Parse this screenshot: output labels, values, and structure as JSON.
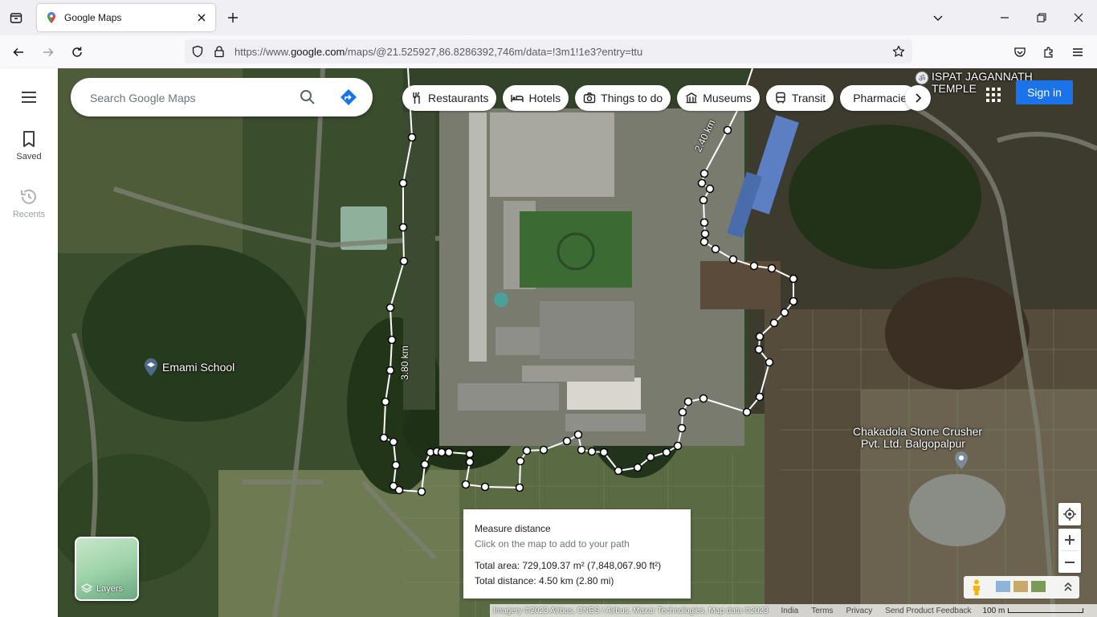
{
  "browser": {
    "tab_title": "Google Maps",
    "url_prefix": "https://www.",
    "url_domain": "google.com",
    "url_rest": "/maps/@21.525927,86.8286392,746m/data=!3m1!1e3?entry=ttu"
  },
  "rail": {
    "saved_label": "Saved",
    "recents_label": "Recents"
  },
  "search": {
    "placeholder": "Search Google Maps"
  },
  "chips": {
    "restaurants": "Restaurants",
    "hotels": "Hotels",
    "things_to_do": "Things to do",
    "museums": "Museums",
    "transit": "Transit",
    "pharmacies": "Pharmacies"
  },
  "header": {
    "sign_in": "Sign in"
  },
  "map_labels": {
    "temple_line1": "ISPAT JAGANNATH",
    "temple_line2": "TEMPLE",
    "emami_school": "Emami School",
    "crusher_line1": "Chakadola Stone Crusher",
    "crusher_line2": "Pvt. Ltd. Balgopalpur",
    "dist_top": "2.40 km",
    "dist_left": "3.80 km"
  },
  "measure": {
    "title": "Measure distance",
    "hint": "Click on the map to add to your path",
    "total_area": "Total area: 729,109.37 m² (7,848,067.90 ft²)",
    "total_distance": "Total distance: 4.50 km (2.80 mi)"
  },
  "layers": {
    "label": "Layers"
  },
  "footer": {
    "imagery": "Imagery ©2023 Airbus, CNES / Airbus, Maxar Technologies, Map data ©2023",
    "india": "India",
    "terms": "Terms",
    "privacy": "Privacy",
    "feedback": "Send Product Feedback",
    "scale": "100 m"
  },
  "colors": {
    "accent": "#1a73e8",
    "map_dark": "#2e3f25",
    "path": "#ffffff"
  }
}
